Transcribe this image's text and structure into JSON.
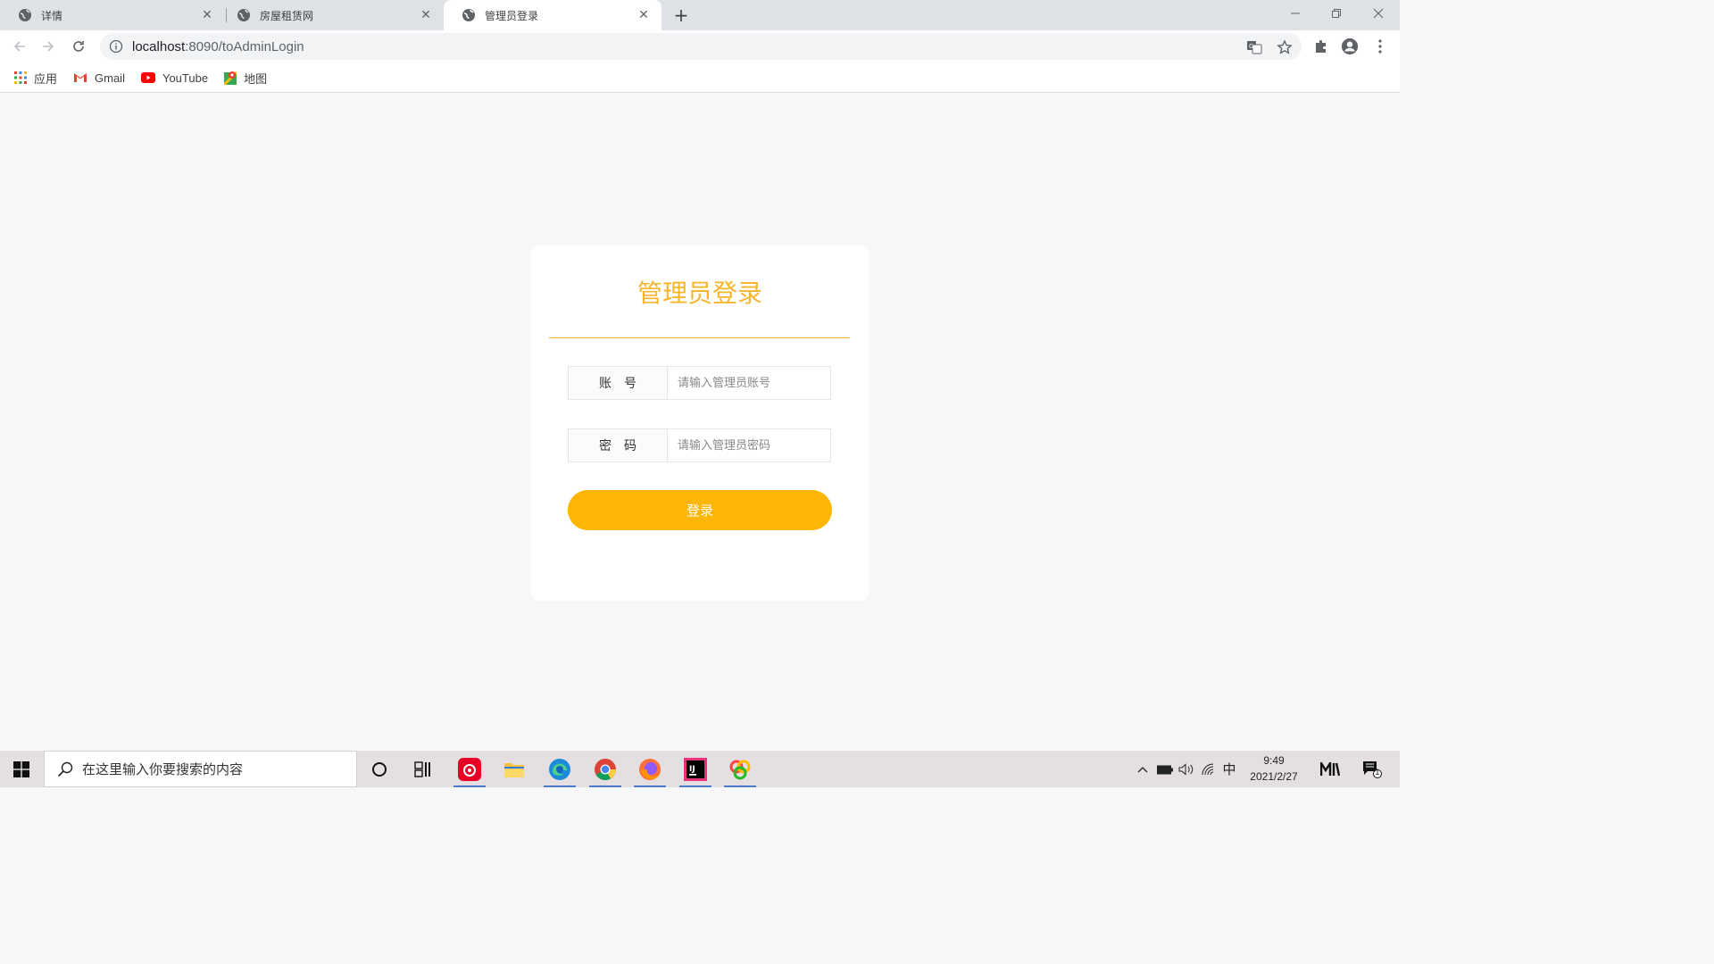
{
  "browser": {
    "tabs": [
      {
        "title": "详情",
        "active": false
      },
      {
        "title": "房屋租赁网",
        "active": false
      },
      {
        "title": "管理员登录",
        "active": true
      }
    ],
    "url_host": "localhost",
    "url_rest": ":8090/toAdminLogin",
    "bookmarks": [
      {
        "label": "应用",
        "icon": "apps-grid-icon"
      },
      {
        "label": "Gmail",
        "icon": "gmail-icon"
      },
      {
        "label": "YouTube",
        "icon": "youtube-icon"
      },
      {
        "label": "地图",
        "icon": "maps-icon"
      }
    ]
  },
  "login": {
    "title": "管理员登录",
    "account_label": "账号",
    "account_placeholder": "请输入管理员账号",
    "password_label": "密码",
    "password_placeholder": "请输入管理员密码",
    "submit_label": "登录",
    "accent_color": "#f7b52c",
    "button_color": "#feb606"
  },
  "taskbar": {
    "search_placeholder": "在这里输入你要搜索的内容",
    "time": "9:49",
    "date": "2021/2/27",
    "ime": "中",
    "notification_count": "1"
  }
}
